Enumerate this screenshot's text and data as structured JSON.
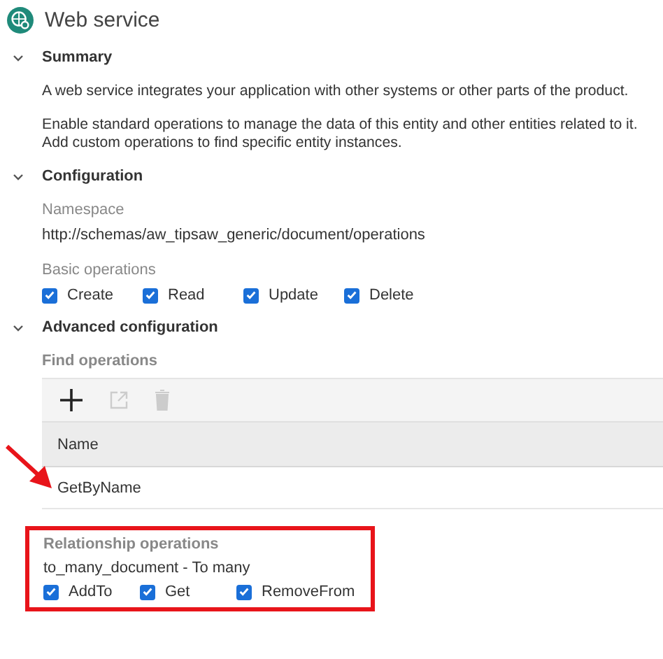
{
  "header": {
    "title": "Web service"
  },
  "sections": [
    {
      "kind": "summary",
      "title": "Summary",
      "expanded": true,
      "paragraphs": [
        "A web service integrates your application with other systems or other parts of the product.",
        "Enable standard operations to manage the data of this entity and other entities related to it. Add custom operations to find specific entity instances."
      ]
    },
    {
      "kind": "configuration",
      "title": "Configuration",
      "expanded": true,
      "namespace_label": "Namespace",
      "namespace": "http://schemas/aw_tipsaw_generic/document/operations",
      "basic_label": "Basic operations",
      "basic_operations": [
        {
          "label": "Create",
          "checked": true
        },
        {
          "label": "Read",
          "checked": true
        },
        {
          "label": "Update",
          "checked": true
        },
        {
          "label": "Delete",
          "checked": true
        }
      ]
    },
    {
      "kind": "advanced",
      "title": "Advanced configuration",
      "expanded": true,
      "find_label": "Find operations",
      "toolbar": [
        {
          "kind": "add",
          "disabled": false
        },
        {
          "kind": "open",
          "disabled": true
        },
        {
          "kind": "delete",
          "disabled": true
        }
      ],
      "columns": [
        "Name"
      ],
      "rows": [
        "GetByName"
      ],
      "relationship": {
        "label": "Relationship operations",
        "name": "to_many_document - To many",
        "operations": [
          {
            "label": "AddTo",
            "checked": true
          },
          {
            "label": "Get",
            "checked": true
          },
          {
            "label": "RemoveFrom",
            "checked": true
          }
        ]
      }
    }
  ]
}
